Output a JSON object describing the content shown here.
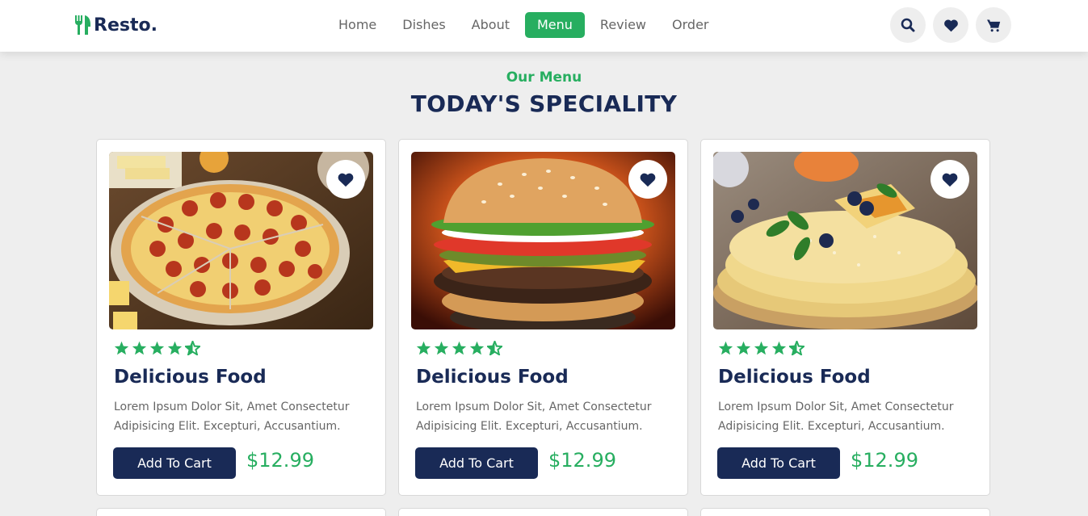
{
  "brand": {
    "name": "Resto.",
    "icon": "utensils-icon"
  },
  "nav": {
    "items": [
      {
        "label": "Home",
        "active": false
      },
      {
        "label": "Dishes",
        "active": false
      },
      {
        "label": "About",
        "active": false
      },
      {
        "label": "Menu",
        "active": true
      },
      {
        "label": "Review",
        "active": false
      },
      {
        "label": "Order",
        "active": false
      }
    ]
  },
  "header_icons": [
    "search-icon",
    "heart-icon",
    "cart-icon"
  ],
  "section": {
    "sub_heading": "Our Menu",
    "heading": "TODAY'S SPECIALITY"
  },
  "cards": [
    {
      "image": "pizza",
      "rating": 4.5,
      "title": "Delicious Food",
      "description": "Lorem Ipsum Dolor Sit, Amet Consectetur Adipisicing Elit. Excepturi, Accusantium.",
      "button_label": "Add To Cart",
      "price": "$12.99"
    },
    {
      "image": "burger",
      "rating": 4.5,
      "title": "Delicious Food",
      "description": "Lorem Ipsum Dolor Sit, Amet Consectetur Adipisicing Elit. Excepturi, Accusantium.",
      "button_label": "Add To Cart",
      "price": "$12.99"
    },
    {
      "image": "crepes",
      "rating": 4.5,
      "title": "Delicious Food",
      "description": "Lorem Ipsum Dolor Sit, Amet Consectetur Adipisicing Elit. Excepturi, Accusantium.",
      "button_label": "Add To Cart",
      "price": "$12.99"
    }
  ],
  "colors": {
    "accent": "#27ae60",
    "primary": "#192a56",
    "text_muted": "#666666",
    "background": "#eeeeee"
  }
}
